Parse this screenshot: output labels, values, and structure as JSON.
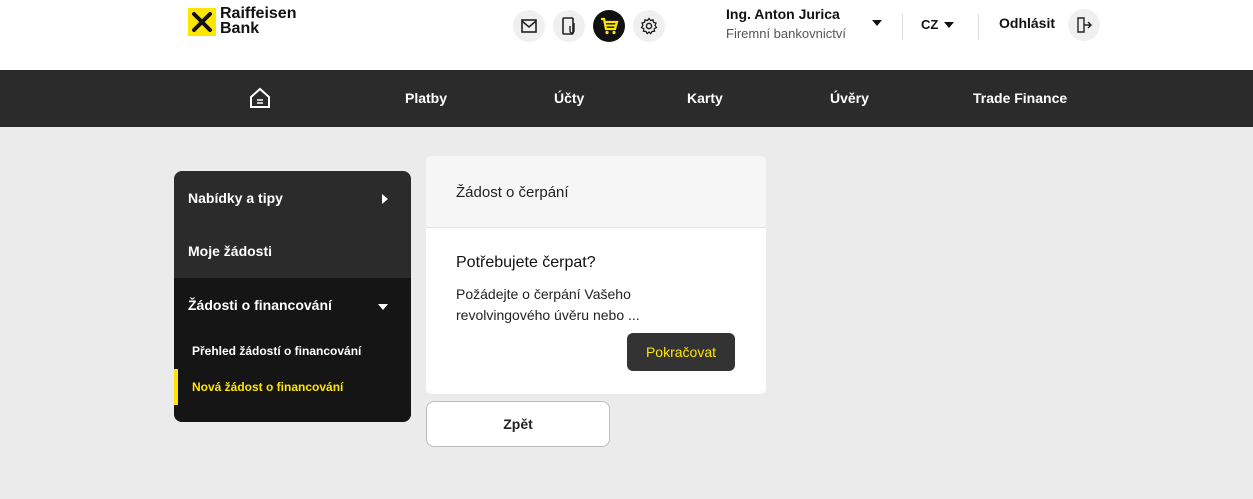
{
  "brand": {
    "line1": "Raiffeisen",
    "line2": "Bank",
    "accent": "#fee600"
  },
  "header": {
    "icons": [
      "mail-icon",
      "document-icon",
      "cart-icon",
      "settings-icon"
    ],
    "user_name": "Ing. Anton Jurica",
    "user_role": "Firemní bankovnictví",
    "language": "CZ",
    "logout": "Odhlásit"
  },
  "nav": {
    "items": [
      "Platby",
      "Účty",
      "Karty",
      "Úvěry",
      "Trade Finance"
    ]
  },
  "sidebar": {
    "items": [
      "Nabídky a tipy",
      "Moje žádosti",
      "Žádosti o financování"
    ],
    "subitems": [
      "Přehled žádostí o financování",
      "Nová žádost o financování"
    ]
  },
  "card": {
    "header": "Žádost o čerpání",
    "title": "Potřebujete čerpat?",
    "text": "Požádejte o čerpání Vašeho revolvingového úvěru nebo ...",
    "button": "Pokračovat"
  },
  "back_button": "Zpět"
}
